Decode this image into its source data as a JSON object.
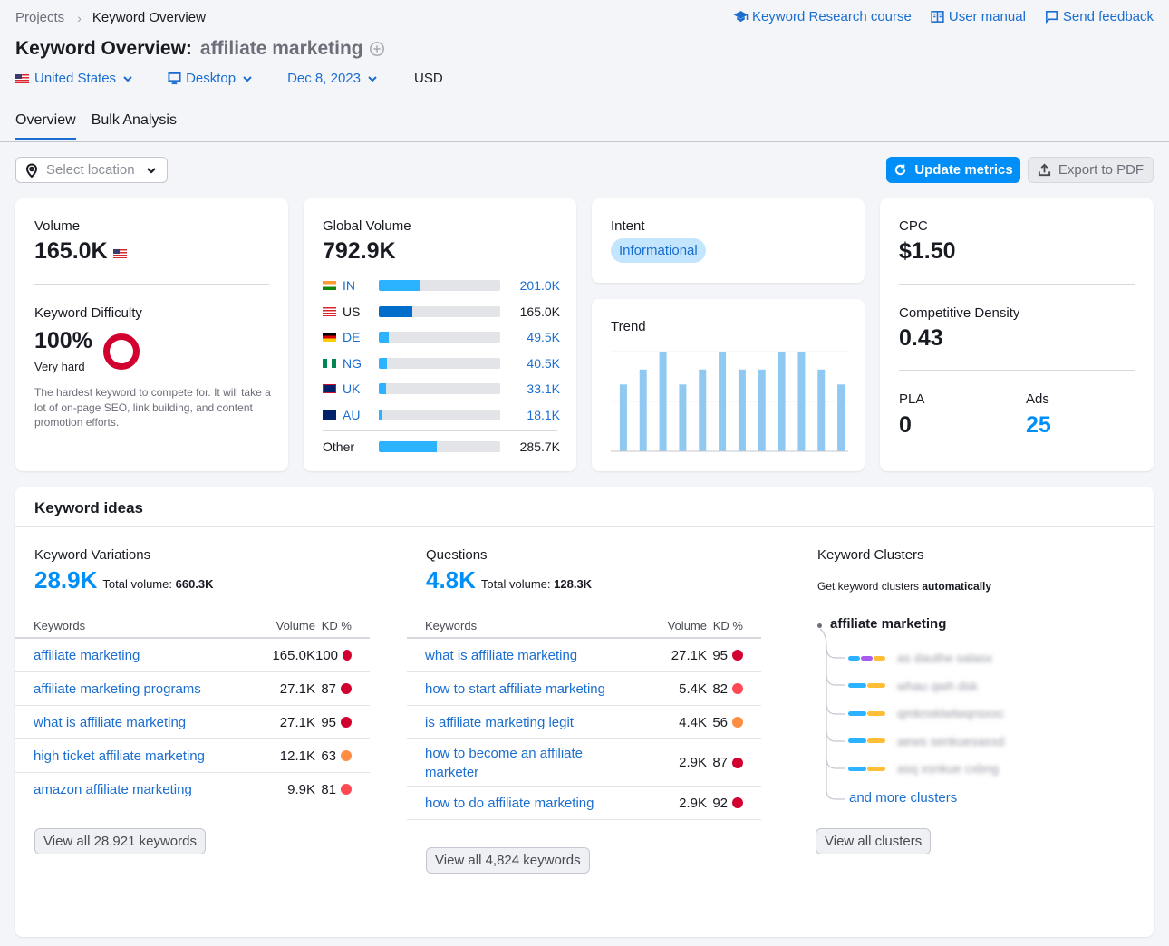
{
  "breadcrumb": {
    "parent": "Projects",
    "current": "Keyword Overview"
  },
  "top_links": [
    {
      "label": "Keyword Research course",
      "icon": "graduation-cap-icon"
    },
    {
      "label": "User manual",
      "icon": "book-icon"
    },
    {
      "label": "Send feedback",
      "icon": "chat-bubble-icon"
    }
  ],
  "title": {
    "prefix": "Keyword Overview:",
    "keyword": "affiliate marketing"
  },
  "filters": {
    "country": "United States",
    "device": "Desktop",
    "date": "Dec 8, 2023",
    "currency": "USD"
  },
  "tabs": [
    {
      "label": "Overview",
      "active": true
    },
    {
      "label": "Bulk Analysis",
      "active": false
    }
  ],
  "location_select": {
    "placeholder": "Select location"
  },
  "actions": {
    "update": "Update metrics",
    "export": "Export to PDF"
  },
  "volume": {
    "label": "Volume",
    "value": "165.0K"
  },
  "keyword_difficulty": {
    "label": "Keyword Difficulty",
    "value": "100%",
    "percent": 100,
    "level": "Very hard",
    "description": "The hardest keyword to compete for. It will take a lot of on-page SEO, link building, and content promotion efforts.",
    "color": "#d1002f"
  },
  "global_volume": {
    "label": "Global Volume",
    "value": "792.9K",
    "countries": [
      {
        "code": "IN",
        "value": "201.0K",
        "share": 0.254,
        "link": true
      },
      {
        "code": "US",
        "value": "165.0K",
        "share": 0.208,
        "link": false
      },
      {
        "code": "DE",
        "value": "49.5K",
        "share": 0.062,
        "link": true
      },
      {
        "code": "NG",
        "value": "40.5K",
        "share": 0.051,
        "link": true
      },
      {
        "code": "UK",
        "value": "33.1K",
        "share": 0.042,
        "link": true
      },
      {
        "code": "AU",
        "value": "18.1K",
        "share": 0.023,
        "link": true
      }
    ],
    "other": {
      "label": "Other",
      "value": "285.7K",
      "share": 0.36
    }
  },
  "intent": {
    "label": "Intent",
    "value": "Informational"
  },
  "trend": {
    "label": "Trend",
    "values": [
      0.67,
      0.82,
      1.0,
      0.67,
      0.82,
      1.0,
      0.82,
      0.82,
      1.0,
      1.0,
      0.82,
      0.67
    ]
  },
  "cpc": {
    "label": "CPC",
    "value": "$1.50"
  },
  "competitive_density": {
    "label": "Competitive Density",
    "value": "0.43"
  },
  "pla": {
    "label": "PLA",
    "value": "0"
  },
  "ads": {
    "label": "Ads",
    "value": "25"
  },
  "keyword_ideas": {
    "title": "Keyword ideas",
    "variations": {
      "title": "Keyword Variations",
      "count": "28.9K",
      "total_label": "Total volume:",
      "total": "660.3K",
      "headers": {
        "keyword": "Keywords",
        "volume": "Volume",
        "kd": "KD %"
      },
      "rows": [
        {
          "keyword": "affiliate marketing",
          "volume": "165.0K",
          "kd": "100",
          "kd_color": "#d1002f"
        },
        {
          "keyword": "affiliate marketing programs",
          "volume": "27.1K",
          "kd": "87",
          "kd_color": "#d1002f"
        },
        {
          "keyword": "what is affiliate marketing",
          "volume": "27.1K",
          "kd": "95",
          "kd_color": "#d1002f"
        },
        {
          "keyword": "high ticket affiliate marketing",
          "volume": "12.1K",
          "kd": "63",
          "kd_color": "#ff8c43"
        },
        {
          "keyword": "amazon affiliate marketing",
          "volume": "9.9K",
          "kd": "81",
          "kd_color": "#ff4953"
        }
      ],
      "view_all": "View all 28,921 keywords"
    },
    "questions": {
      "title": "Questions",
      "count": "4.8K",
      "total_label": "Total volume:",
      "total": "128.3K",
      "headers": {
        "keyword": "Keywords",
        "volume": "Volume",
        "kd": "KD %"
      },
      "rows": [
        {
          "keyword": "what is affiliate marketing",
          "volume": "27.1K",
          "kd": "95",
          "kd_color": "#d1002f"
        },
        {
          "keyword": "how to start affiliate marketing",
          "volume": "5.4K",
          "kd": "82",
          "kd_color": "#ff4953"
        },
        {
          "keyword": "is affiliate marketing legit",
          "volume": "4.4K",
          "kd": "56",
          "kd_color": "#ff8c43"
        },
        {
          "keyword": "how to become an affiliate marketer",
          "volume": "2.9K",
          "kd": "87",
          "kd_color": "#d1002f"
        },
        {
          "keyword": "how to do affiliate marketing",
          "volume": "2.9K",
          "kd": "92",
          "kd_color": "#d1002f"
        }
      ],
      "view_all": "View all 4,824 keywords"
    },
    "clusters": {
      "title": "Keyword Clusters",
      "subtitle_prefix": "Get keyword clusters ",
      "subtitle_bold": "automatically",
      "root": "affiliate marketing",
      "items": [
        {
          "text": "as dauthe salasx",
          "segments": [
            "#2bb3ff",
            "#a75cf0",
            "#ffbe37"
          ]
        },
        {
          "text": "whau qwh dsk",
          "segments": [
            "#2bb3ff",
            "#ffbe37"
          ]
        },
        {
          "text": "qmknxklwlwqnsxxc",
          "segments": [
            "#2bb3ff",
            "#ffbe37"
          ]
        },
        {
          "text": "aews senkuesaxxd",
          "segments": [
            "#2bb3ff",
            "#ffbe37"
          ]
        },
        {
          "text": "asq xsnkue cxbng",
          "segments": [
            "#2bb3ff",
            "#ffbe37"
          ]
        }
      ],
      "more": "and more clusters",
      "view_all": "View all clusters"
    }
  },
  "colors": {
    "accent": "#008ff8",
    "link": "#1a6ed0",
    "bar": "#2bb3ff",
    "bar_us": "#006dca",
    "trend_bar": "#8fc8f0"
  }
}
